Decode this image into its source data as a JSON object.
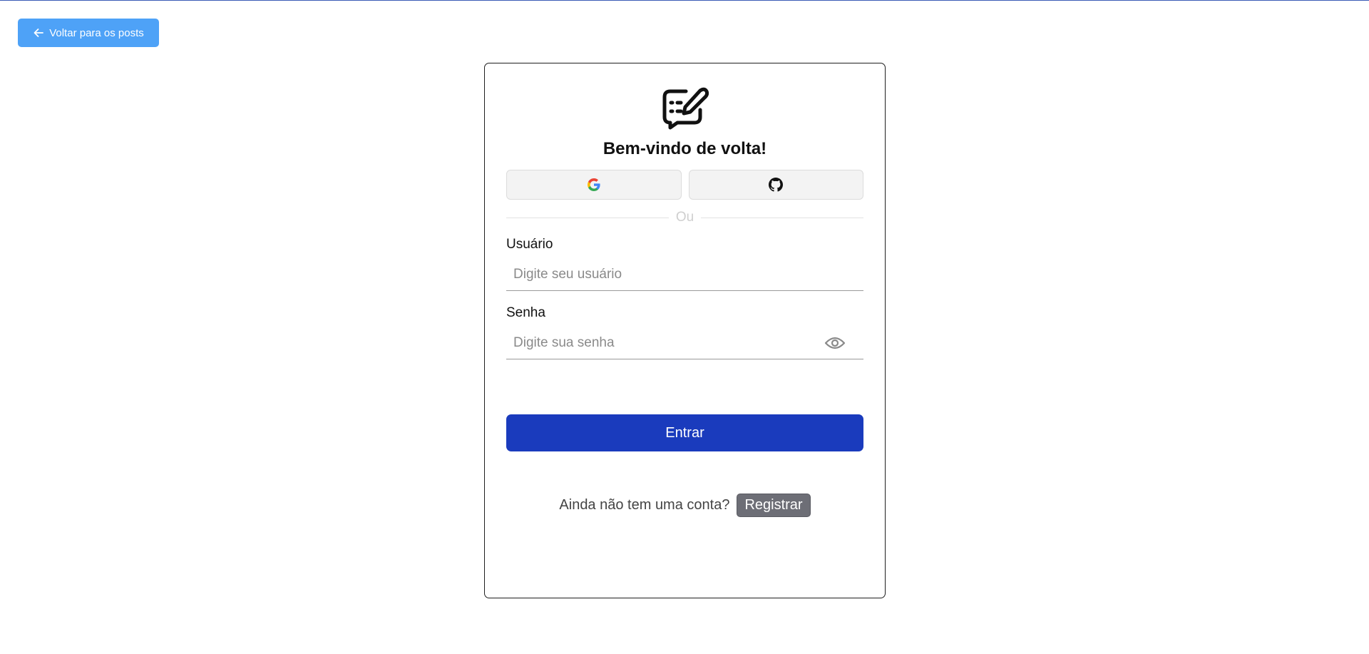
{
  "back_button": {
    "label": "Voltar para os posts",
    "icon": "arrow-left-icon",
    "color": "#4ea2f7"
  },
  "login": {
    "title": "Bem-vindo de volta!",
    "logo_icon": "edit-note-icon",
    "social": [
      {
        "provider": "Google",
        "icon": "google-icon"
      },
      {
        "provider": "GitHub",
        "icon": "github-icon"
      }
    ],
    "divider_text": "Ou",
    "username": {
      "label": "Usuário",
      "placeholder": "Digite seu usuário",
      "value": ""
    },
    "password": {
      "label": "Senha",
      "placeholder": "Digite sua senha",
      "value": "",
      "toggle_icon": "eye-icon"
    },
    "submit_label": "Entrar",
    "submit_color": "#1a3bbd",
    "register_prompt": "Ainda não tem uma conta?",
    "register_label": "Registrar"
  }
}
